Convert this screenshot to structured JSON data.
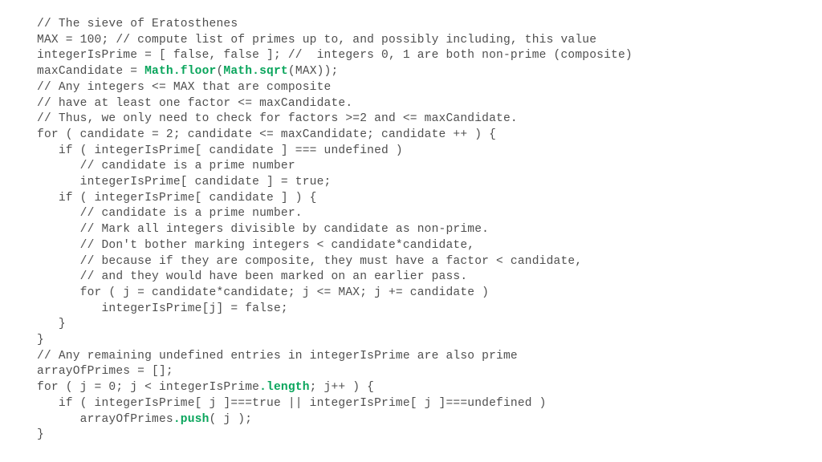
{
  "document": {
    "type": "code-listing",
    "language": "javascript",
    "title": "The sieve of Eratosthenes",
    "background_color": "#ffffff",
    "text_color": "#4f4f4f",
    "highlight_color": "#0aa55c"
  },
  "code": {
    "lines": [
      {
        "id": 1,
        "segments": [
          {
            "t": "// The sieve of Eratosthenes",
            "s": "plain"
          }
        ]
      },
      {
        "id": 2,
        "segments": [
          {
            "t": "MAX = 100; // compute list of primes up to, and possibly including, this value",
            "s": "plain"
          }
        ]
      },
      {
        "id": 3,
        "segments": [
          {
            "t": "integerIsPrime = [ false, false ]; //  integers 0, 1 are both non-prime (composite)",
            "s": "plain"
          }
        ]
      },
      {
        "id": 4,
        "segments": [
          {
            "t": "maxCandidate = ",
            "s": "plain"
          },
          {
            "t": "Math.floor",
            "s": "keyword"
          },
          {
            "t": "(",
            "s": "plain"
          },
          {
            "t": "Math.sqrt",
            "s": "keyword"
          },
          {
            "t": "(MAX));",
            "s": "plain"
          }
        ]
      },
      {
        "id": 5,
        "segments": [
          {
            "t": "// Any integers <= MAX that are composite",
            "s": "plain"
          }
        ]
      },
      {
        "id": 6,
        "segments": [
          {
            "t": "// have at least one factor <= maxCandidate.",
            "s": "plain"
          }
        ]
      },
      {
        "id": 7,
        "segments": [
          {
            "t": "// Thus, we only need to check for factors >=2 and <= maxCandidate.",
            "s": "plain"
          }
        ]
      },
      {
        "id": 8,
        "segments": [
          {
            "t": "for ( candidate = 2; candidate <= maxCandidate; candidate ++ ) {",
            "s": "plain"
          }
        ]
      },
      {
        "id": 9,
        "segments": [
          {
            "t": "   if ( integerIsPrime[ candidate ] === undefined )",
            "s": "plain"
          }
        ]
      },
      {
        "id": 10,
        "segments": [
          {
            "t": "      // candidate is a prime number",
            "s": "plain"
          }
        ]
      },
      {
        "id": 11,
        "segments": [
          {
            "t": "      integerIsPrime[ candidate ] = true;",
            "s": "plain"
          }
        ]
      },
      {
        "id": 12,
        "segments": [
          {
            "t": "   if ( integerIsPrime[ candidate ] ) {",
            "s": "plain"
          }
        ]
      },
      {
        "id": 13,
        "segments": [
          {
            "t": "      // candidate is a prime number.",
            "s": "plain"
          }
        ]
      },
      {
        "id": 14,
        "segments": [
          {
            "t": "      // Mark all integers divisible by candidate as non-prime.",
            "s": "plain"
          }
        ]
      },
      {
        "id": 15,
        "segments": [
          {
            "t": "      // Don't bother marking integers < candidate*candidate,",
            "s": "plain"
          }
        ]
      },
      {
        "id": 16,
        "segments": [
          {
            "t": "      // because if they are composite, they must have a factor < candidate,",
            "s": "plain"
          }
        ]
      },
      {
        "id": 17,
        "segments": [
          {
            "t": "      // and they would have been marked on an earlier pass.",
            "s": "plain"
          }
        ]
      },
      {
        "id": 18,
        "segments": [
          {
            "t": "      for ( j = candidate*candidate; j <= MAX; j += candidate )",
            "s": "plain"
          }
        ]
      },
      {
        "id": 19,
        "segments": [
          {
            "t": "         integerIsPrime[j] = false;",
            "s": "plain"
          }
        ]
      },
      {
        "id": 20,
        "segments": [
          {
            "t": "   }",
            "s": "plain"
          }
        ]
      },
      {
        "id": 21,
        "segments": [
          {
            "t": "}",
            "s": "plain"
          }
        ]
      },
      {
        "id": 22,
        "segments": [
          {
            "t": "// Any remaining undefined entries in integerIsPrime are also prime",
            "s": "plain"
          }
        ]
      },
      {
        "id": 23,
        "segments": [
          {
            "t": "arrayOfPrimes = [];",
            "s": "plain"
          }
        ]
      },
      {
        "id": 24,
        "segments": [
          {
            "t": "for ( j = 0; j < integerIsPrime",
            "s": "plain"
          },
          {
            "t": ".length",
            "s": "keyword"
          },
          {
            "t": "; j++ ) {",
            "s": "plain"
          }
        ]
      },
      {
        "id": 25,
        "segments": [
          {
            "t": "   if ( integerIsPrime[ j ]===true || integerIsPrime[ j ]===undefined )",
            "s": "plain"
          }
        ]
      },
      {
        "id": 26,
        "segments": [
          {
            "t": "      arrayOfPrimes",
            "s": "plain"
          },
          {
            "t": ".push",
            "s": "keyword"
          },
          {
            "t": "( j );",
            "s": "plain"
          }
        ]
      },
      {
        "id": 27,
        "segments": [
          {
            "t": "}",
            "s": "plain"
          }
        ]
      }
    ]
  }
}
